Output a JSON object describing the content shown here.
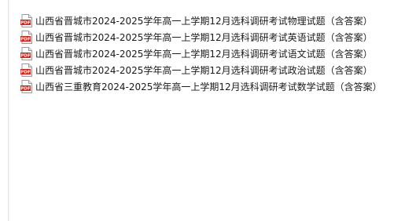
{
  "colors": {
    "pdf_red": "#c8261c",
    "text": "#1a1a1a",
    "pane_divider": "#e3e6ea"
  },
  "files": [
    {
      "icon": "pdf-file-icon",
      "badge": "PDF",
      "name": "山西省晋城市2024-2025学年高一上学期12月选科调研考试物理试题（含答案）"
    },
    {
      "icon": "pdf-file-icon",
      "badge": "PDF",
      "name": "山西省晋城市2024-2025学年高一上学期12月选科调研考试英语试题（含答案）"
    },
    {
      "icon": "pdf-file-icon",
      "badge": "PDF",
      "name": "山西省晋城市2024-2025学年高一上学期12月选科调研考试语文试题（含答案）"
    },
    {
      "icon": "pdf-file-icon",
      "badge": "PDF",
      "name": "山西省晋城市2024-2025学年高一上学期12月选科调研考试政治试题（含答案）"
    },
    {
      "icon": "pdf-file-icon",
      "badge": "PDF",
      "name": "山西省三重教育2024-2025学年高一上学期12月选科调研考试数学试题（含答案）"
    }
  ]
}
